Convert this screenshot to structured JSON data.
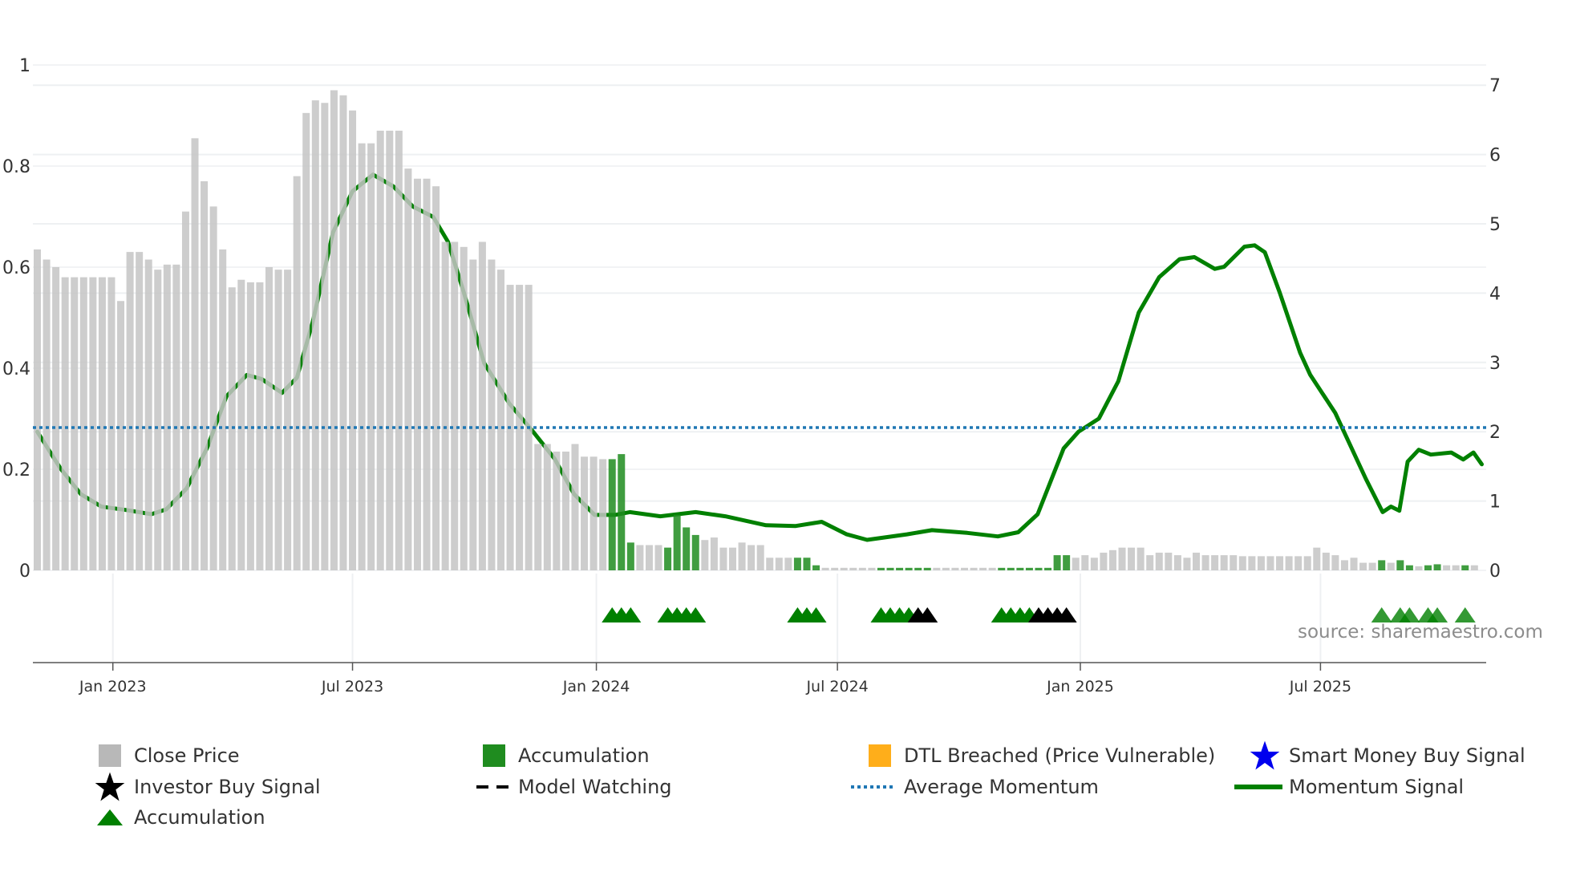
{
  "chart_data": {
    "type": "bar",
    "title": "",
    "x_unit": "week index",
    "left_axis": {
      "ylim": [
        0,
        1
      ],
      "ticks": [
        "0",
        "0.2",
        "0.4",
        "0.6",
        "0.8",
        "1"
      ],
      "tick_values": [
        0,
        0.2,
        0.4,
        0.6,
        0.8,
        1
      ]
    },
    "right_axis": {
      "ylim": [
        0,
        7
      ],
      "ticks": [
        "0",
        "1",
        "2",
        "3",
        "4",
        "5",
        "6",
        "7"
      ],
      "tick_values": [
        0,
        1,
        2,
        3,
        4,
        5,
        6,
        7
      ]
    },
    "x_ticks": [
      {
        "label": "Jan 2023",
        "week": 8.15
      },
      {
        "label": "Jul 2023",
        "week": 34.0
      },
      {
        "label": "Jan 2024",
        "week": 60.3
      },
      {
        "label": "Jul 2024",
        "week": 86.3
      },
      {
        "label": "Jan 2025",
        "week": 112.5
      },
      {
        "label": "Jul 2025",
        "week": 138.4
      }
    ],
    "close_price": [
      0.635,
      0.615,
      0.6,
      0.58,
      0.58,
      0.58,
      0.58,
      0.58,
      0.58,
      0.533,
      0.63,
      0.63,
      0.615,
      0.595,
      0.605,
      0.605,
      0.71,
      0.855,
      0.77,
      0.72,
      0.635,
      0.56,
      0.575,
      0.57,
      0.57,
      0.6,
      0.595,
      0.595,
      0.78,
      0.905,
      0.93,
      0.925,
      0.95,
      0.94,
      0.91,
      0.845,
      0.845,
      0.87,
      0.87,
      0.87,
      0.795,
      0.775,
      0.775,
      0.76,
      0.65,
      0.65,
      0.64,
      0.615,
      0.65,
      0.615,
      0.595,
      0.565,
      0.565,
      0.565,
      0.25,
      0.25,
      0.235,
      0.235,
      0.25,
      0.225,
      0.225,
      0.22,
      0.22,
      0.23,
      0.055,
      0.05,
      0.05,
      0.05,
      0.045,
      0.11,
      0.085,
      0.07,
      0.06,
      0.065,
      0.045,
      0.045,
      0.055,
      0.05,
      0.05,
      0.025,
      0.025,
      0.025,
      0.025,
      0.025,
      0.01,
      0.005,
      0.005,
      0.005,
      0.005,
      0.005,
      0.005,
      0.005,
      0.005,
      0.005,
      0.005,
      0.005,
      0.005,
      0.005,
      0.005,
      0.005,
      0.005,
      0.005,
      0.005,
      0.005,
      0.005,
      0.005,
      0.005,
      0.005,
      0.005,
      0.005,
      0.03,
      0.03,
      0.025,
      0.03,
      0.025,
      0.035,
      0.04,
      0.045,
      0.045,
      0.045,
      0.03,
      0.035,
      0.035,
      0.03,
      0.025,
      0.035,
      0.03,
      0.03,
      0.03,
      0.03,
      0.028,
      0.028,
      0.028,
      0.028,
      0.028,
      0.028,
      0.028,
      0.028,
      0.045,
      0.035,
      0.03,
      0.02,
      0.025,
      0.015,
      0.015,
      0.02,
      0.015,
      0.02,
      0.01,
      0.008,
      0.01,
      0.012,
      0.01,
      0.01,
      0.01,
      0.01
    ],
    "accumulation_bars": [
      62,
      63,
      64,
      68,
      69,
      70,
      71,
      82,
      83,
      84,
      91,
      92,
      93,
      94,
      95,
      96,
      104,
      105,
      106,
      107,
      108,
      109,
      110,
      111,
      145,
      147,
      148,
      150,
      151,
      154
    ],
    "accumulation_triangles": [
      62,
      63,
      64,
      68,
      69,
      70,
      71,
      82,
      83,
      84,
      91,
      92,
      93,
      94,
      104,
      105,
      106,
      107,
      145,
      147,
      148,
      150,
      151,
      154
    ],
    "investor_buy_signals": [
      95,
      96,
      108,
      109,
      110,
      111
    ],
    "average_momentum": 2.06,
    "momentum_signal": [
      [
        0,
        2.0
      ],
      [
        2.5,
        1.47
      ],
      [
        4.7,
        1.1
      ],
      [
        6.9,
        0.92
      ],
      [
        9.6,
        0.87
      ],
      [
        12.3,
        0.81
      ],
      [
        13.9,
        0.88
      ],
      [
        16.1,
        1.18
      ],
      [
        18.3,
        1.76
      ],
      [
        20.4,
        2.51
      ],
      [
        22.6,
        2.82
      ],
      [
        24.2,
        2.76
      ],
      [
        26.4,
        2.56
      ],
      [
        28.0,
        2.78
      ],
      [
        29.7,
        3.58
      ],
      [
        31.9,
        4.88
      ],
      [
        34.0,
        5.47
      ],
      [
        36.2,
        5.71
      ],
      [
        38.4,
        5.54
      ],
      [
        40.5,
        5.25
      ],
      [
        42.7,
        5.1
      ],
      [
        44.3,
        4.74
      ],
      [
        46.0,
        4.01
      ],
      [
        48.2,
        2.99
      ],
      [
        50.9,
        2.41
      ],
      [
        53.6,
        1.98
      ],
      [
        55.8,
        1.61
      ],
      [
        57.9,
        1.1
      ],
      [
        60.1,
        0.8
      ],
      [
        62.3,
        0.8
      ],
      [
        63.9,
        0.84
      ],
      [
        67.2,
        0.78
      ],
      [
        71.0,
        0.84
      ],
      [
        74.2,
        0.78
      ],
      [
        78.6,
        0.65
      ],
      [
        81.8,
        0.64
      ],
      [
        84.6,
        0.7
      ],
      [
        87.3,
        0.52
      ],
      [
        89.5,
        0.44
      ],
      [
        93.8,
        0.52
      ],
      [
        96.5,
        0.58
      ],
      [
        100.3,
        0.54
      ],
      [
        103.6,
        0.49
      ],
      [
        105.8,
        0.55
      ],
      [
        107.9,
        0.81
      ],
      [
        110.7,
        1.76
      ],
      [
        112.3,
        2.0
      ],
      [
        114.5,
        2.19
      ],
      [
        116.6,
        2.73
      ],
      [
        118.8,
        3.72
      ],
      [
        121.0,
        4.23
      ],
      [
        123.2,
        4.49
      ],
      [
        124.8,
        4.52
      ],
      [
        127.0,
        4.35
      ],
      [
        128.0,
        4.38
      ],
      [
        130.2,
        4.67
      ],
      [
        131.3,
        4.69
      ],
      [
        132.4,
        4.59
      ],
      [
        134.0,
        4.01
      ],
      [
        136.2,
        3.14
      ],
      [
        137.3,
        2.82
      ],
      [
        140.0,
        2.27
      ],
      [
        143.3,
        1.32
      ],
      [
        145.1,
        0.84
      ],
      [
        146.0,
        0.92
      ],
      [
        146.9,
        0.86
      ],
      [
        147.8,
        1.57
      ],
      [
        149.0,
        1.74
      ],
      [
        150.3,
        1.67
      ],
      [
        152.5,
        1.7
      ],
      [
        153.8,
        1.6
      ],
      [
        154.9,
        1.7
      ],
      [
        155.8,
        1.53
      ]
    ],
    "source": "source: sharemaestro.com",
    "legend": [
      {
        "label": "Close Price",
        "color": "#b8b8b8",
        "marker": "square"
      },
      {
        "label": "Accumulation",
        "color": "#1f8c1f",
        "marker": "square"
      },
      {
        "label": "DTL Breached (Price Vulnerable)",
        "color": "#ffae1a",
        "marker": "square"
      },
      {
        "label": "Smart Money Buy Signal",
        "color": "#0000ee",
        "marker": "star"
      },
      {
        "label": "Investor Buy Signal",
        "color": "#000000",
        "marker": "star"
      },
      {
        "label": "Model Watching",
        "color": "#000000",
        "marker": "dash"
      },
      {
        "label": "Average Momentum",
        "color": "#1f77b4",
        "marker": "dotted-line"
      },
      {
        "label": "Momentum Signal",
        "color": "#008000",
        "marker": "line"
      },
      {
        "label": "Accumulation",
        "color": "#008000",
        "marker": "triangle"
      }
    ],
    "legend_placement": "bottom"
  }
}
